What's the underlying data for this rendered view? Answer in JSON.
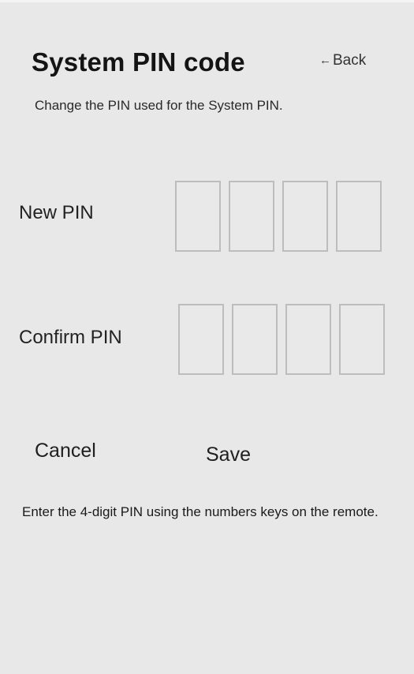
{
  "header": {
    "title": "System PIN code",
    "back_label": "Back",
    "back_arrow": "←",
    "subtitle": "Change the PIN used for the System PIN."
  },
  "new_pin": {
    "label": "New PIN",
    "digits": [
      "",
      "",
      "",
      ""
    ]
  },
  "confirm_pin": {
    "label": "Confirm PIN",
    "digits": [
      "",
      "",
      "",
      ""
    ]
  },
  "actions": {
    "cancel_label": "Cancel",
    "save_label": "Save"
  },
  "hint": "Enter the 4-digit PIN using the numbers keys on the remote.",
  "colors": {
    "background": "#e8e8e8",
    "box_border": "#bdbdbd",
    "text": "#1a1a1a"
  }
}
